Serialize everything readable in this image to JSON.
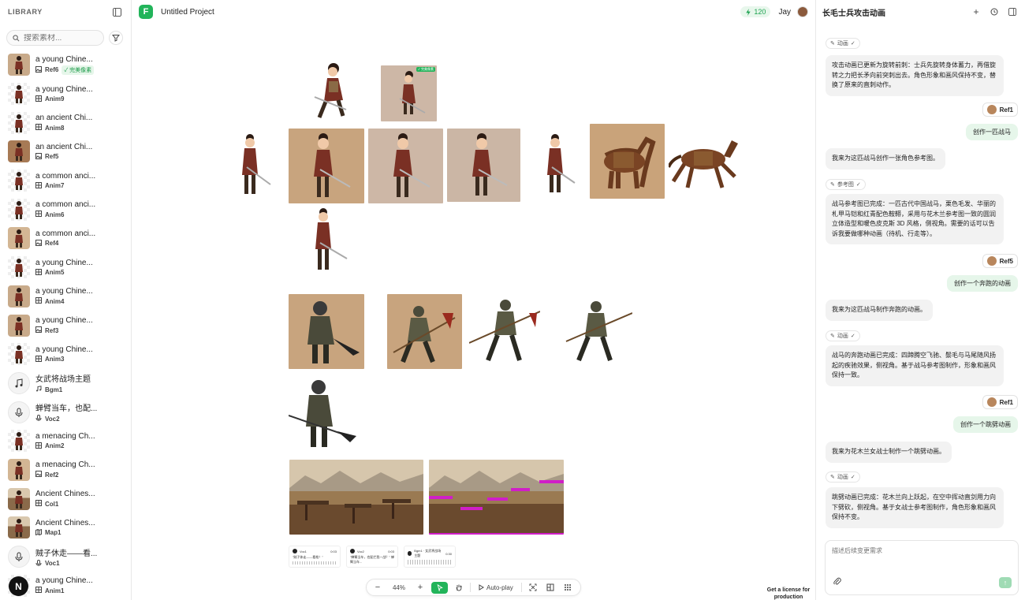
{
  "library": {
    "title": "LIBRARY",
    "search_placeholder": "搜索素材...",
    "assets": [
      {
        "name": "a young Chine...",
        "kind": "image",
        "label": "Ref6",
        "badge": "✓ 完美像素",
        "thumb": "brown"
      },
      {
        "name": "a young Chine...",
        "kind": "anim",
        "label": "Anim9",
        "thumb": "check"
      },
      {
        "name": "an ancient Chi...",
        "kind": "anim",
        "label": "Anim8",
        "thumb": "check"
      },
      {
        "name": "an ancient Chi...",
        "kind": "image",
        "label": "Ref5",
        "thumb": "horse"
      },
      {
        "name": "a common anci...",
        "kind": "anim",
        "label": "Anim7",
        "thumb": "check"
      },
      {
        "name": "a common anci...",
        "kind": "anim",
        "label": "Anim6",
        "thumb": "check"
      },
      {
        "name": "a common anci...",
        "kind": "image",
        "label": "Ref4",
        "thumb": "sil"
      },
      {
        "name": "a young Chine...",
        "kind": "anim",
        "label": "Anim5",
        "thumb": "check"
      },
      {
        "name": "a young Chine...",
        "kind": "anim",
        "label": "Anim4",
        "thumb": "brown"
      },
      {
        "name": "a young Chine...",
        "kind": "image",
        "label": "Ref3",
        "thumb": "brown"
      },
      {
        "name": "a young Chine...",
        "kind": "anim",
        "label": "Anim3",
        "thumb": "check"
      },
      {
        "name": "女武将战场主题",
        "kind": "music",
        "label": "Bgm1",
        "thumb": "icon"
      },
      {
        "name": "蝉臂当车，也配...",
        "kind": "voice",
        "label": "Voc2",
        "thumb": "icon"
      },
      {
        "name": "a menacing Ch...",
        "kind": "anim",
        "label": "Anim2",
        "thumb": "check"
      },
      {
        "name": "a menacing Ch...",
        "kind": "image",
        "label": "Ref2",
        "thumb": "sil"
      },
      {
        "name": "Ancient Chines...",
        "kind": "anim",
        "label": "Col1",
        "thumb": "land"
      },
      {
        "name": "Ancient Chines...",
        "kind": "map",
        "label": "Map1",
        "thumb": "land"
      },
      {
        "name": "贼子休走——看...",
        "kind": "voice",
        "label": "Voc1",
        "thumb": "icon"
      },
      {
        "name": "a young Chine...",
        "kind": "anim",
        "label": "Anim1",
        "thumb": "check"
      }
    ],
    "logo_letter": "N"
  },
  "topbar": {
    "project_logo": "F",
    "project_name": "Untitled Project",
    "credits": "120",
    "user_name": "Jay"
  },
  "canvas": {
    "audio_cards": [
      {
        "title": "Voc1",
        "duration": "0:03",
        "text": "\"贼子休走——看枪！\""
      },
      {
        "title": "Voc2",
        "duration": "0:03",
        "text": "\"蝉臂当车，也配拦我一战？\" 蝉臂当车..."
      },
      {
        "title": "Bgm1 · 女武将战场主题",
        "duration": "0:30",
        "text": ""
      }
    ],
    "preview_badge": "✓ 完美像素"
  },
  "toolbar": {
    "zoom": "44%",
    "autoplay": "Auto-play"
  },
  "license_text": "Get a license for production",
  "chat": {
    "title": "长毛士兵攻击动画",
    "tag_anim": "动画",
    "tag_ref": "参考图",
    "messages": [
      {
        "type": "ai",
        "text": "攻击动画已更新为旋转前刺：士兵先旋转身体蓄力，再借旋转之力把长矛向前突刺出去。角色形象和画风保持不变，替换了原来的直刺动作。"
      },
      {
        "type": "ref",
        "text": "Ref1"
      },
      {
        "type": "user",
        "text": "创作一匹战马"
      },
      {
        "type": "ai",
        "text": "我来为这匹战马创作一张角色参考图。"
      },
      {
        "type": "ai",
        "text": "战马参考图已完成：一匹古代中国战马，栗色毛发、华丽的札甲马铠和红青配色鞍鞯，采用与花木兰参考图一致的圆润立体造型和暖色皮克斯 3D 风格，侧视角。需要的话可以告诉我要做哪种动画（待机、行走等）。"
      },
      {
        "type": "ref",
        "text": "Ref5"
      },
      {
        "type": "user",
        "text": "创作一个奔跑的动画"
      },
      {
        "type": "ai",
        "text": "我来为这匹战马制作奔跑的动画。"
      },
      {
        "type": "ai",
        "text": "战马的奔跑动画已完成：四蹄腾空飞驰、鬃毛与马尾随风扬起的疾驰效果，侧视角。基于战马参考图制作，形象和画风保持一致。"
      },
      {
        "type": "ref",
        "text": "Ref1"
      },
      {
        "type": "user",
        "text": "创作一个跳劈动画"
      },
      {
        "type": "ai",
        "text": "我来为花木兰女战士制作一个跳劈动画。"
      },
      {
        "type": "ai",
        "text": "跳劈动画已完成：花木兰向上跃起，在空中挥动直剑用力向下劈砍，侧视角。基于女战士参考图制作，角色形象和画风保持不变。"
      }
    ],
    "input_placeholder": "描述后续变更需求"
  }
}
